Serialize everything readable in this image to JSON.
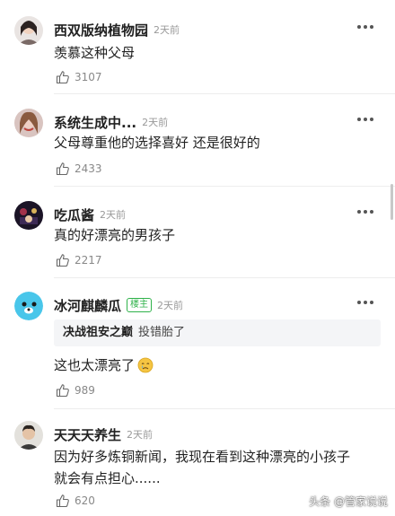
{
  "comments": [
    {
      "username": "西双版纳植物园",
      "time": "2天前",
      "text": "羡慕这种父母",
      "likes": "3107"
    },
    {
      "username": "系统生成中...",
      "time": "2天前",
      "text": "父母尊重他的选择喜好 还是很好的",
      "likes": "2433"
    },
    {
      "username": "吃瓜酱",
      "time": "2天前",
      "text": "真的好漂亮的男孩子",
      "likes": "2217"
    },
    {
      "username": "冰河麒麟瓜",
      "badge": "楼主",
      "time": "2天前",
      "reply": {
        "username": "决战祖安之巅",
        "text": "投错胎了"
      },
      "text": "这也太漂亮了",
      "likes": "989"
    },
    {
      "username": "天天天养生",
      "time": "2天前",
      "text_line1": "因为好多炼铜新闻，我现在看到这种漂亮的小孩子",
      "text_line2": "就会有点担心......",
      "likes": "620"
    }
  ],
  "watermark": "头条 @管家说说",
  "colors": {
    "badge": "#2fb24a",
    "text": "#222222",
    "meta": "#999999",
    "reply_bg": "#f4f5f7"
  }
}
